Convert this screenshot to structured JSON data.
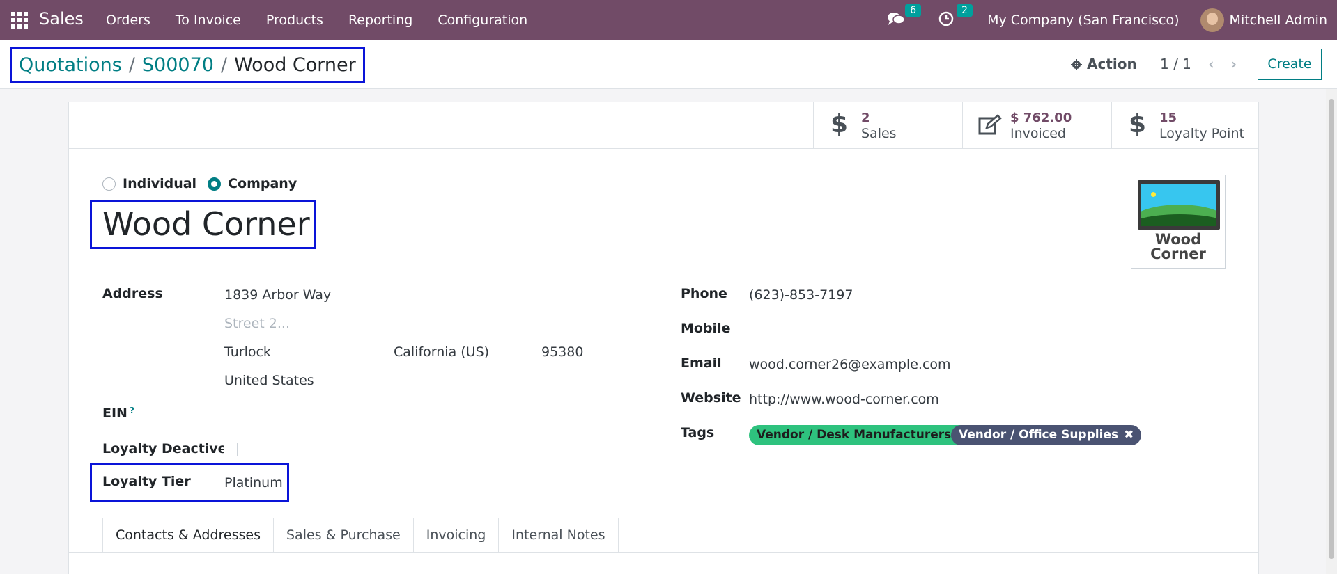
{
  "navbar": {
    "app_name": "Sales",
    "menu": [
      "Orders",
      "To Invoice",
      "Products",
      "Reporting",
      "Configuration"
    ],
    "messages_count": "6",
    "activities_count": "2",
    "company": "My Company (San Francisco)",
    "user": "Mitchell Admin"
  },
  "breadcrumb": {
    "items": [
      "Quotations",
      "S00070",
      "Wood Corner"
    ],
    "separator": "/"
  },
  "control": {
    "action_label": "Action",
    "pager": "1 / 1",
    "create_label": "Create"
  },
  "stats": [
    {
      "value": "2",
      "label": "Sales",
      "icon": "dollar-icon"
    },
    {
      "value": "$ 762.00",
      "label": "Invoiced",
      "icon": "pencil-square-icon"
    },
    {
      "value": "15",
      "label": "Loyalty Point",
      "icon": "dollar-icon"
    }
  ],
  "company_type": {
    "options": [
      "Individual",
      "Company"
    ],
    "selected": "Company"
  },
  "partner": {
    "name": "Wood Corner",
    "logo_text": "Wood Corner"
  },
  "address": {
    "label": "Address",
    "street": "1839 Arbor Way",
    "street2_placeholder": "Street 2...",
    "city": "Turlock",
    "state": "California (US)",
    "zip": "95380",
    "country": "United States"
  },
  "ein": {
    "label": "EIN",
    "help": "?"
  },
  "loyalty_deactive": {
    "label": "Loyalty Deactive",
    "checked": false
  },
  "loyalty_tier": {
    "label": "Loyalty Tier",
    "value": "Platinum"
  },
  "contact": {
    "phone_label": "Phone",
    "phone": "(623)-853-7197",
    "mobile_label": "Mobile",
    "mobile": "",
    "email_label": "Email",
    "email": "wood.corner26@example.com",
    "website_label": "Website",
    "website": "http://www.wood-corner.com",
    "tags_label": "Tags",
    "tags": [
      {
        "label": "Vendor / Desk Manufacturers",
        "color": "#2ec27e"
      },
      {
        "label": "Vendor / Office Supplies",
        "color": "#4a5372"
      }
    ]
  },
  "tabs": [
    "Contacts & Addresses",
    "Sales & Purchase",
    "Invoicing",
    "Internal Notes"
  ],
  "colors": {
    "brand": "#714b67",
    "accent": "#017e84",
    "highlight_border": "#0a14d8"
  }
}
